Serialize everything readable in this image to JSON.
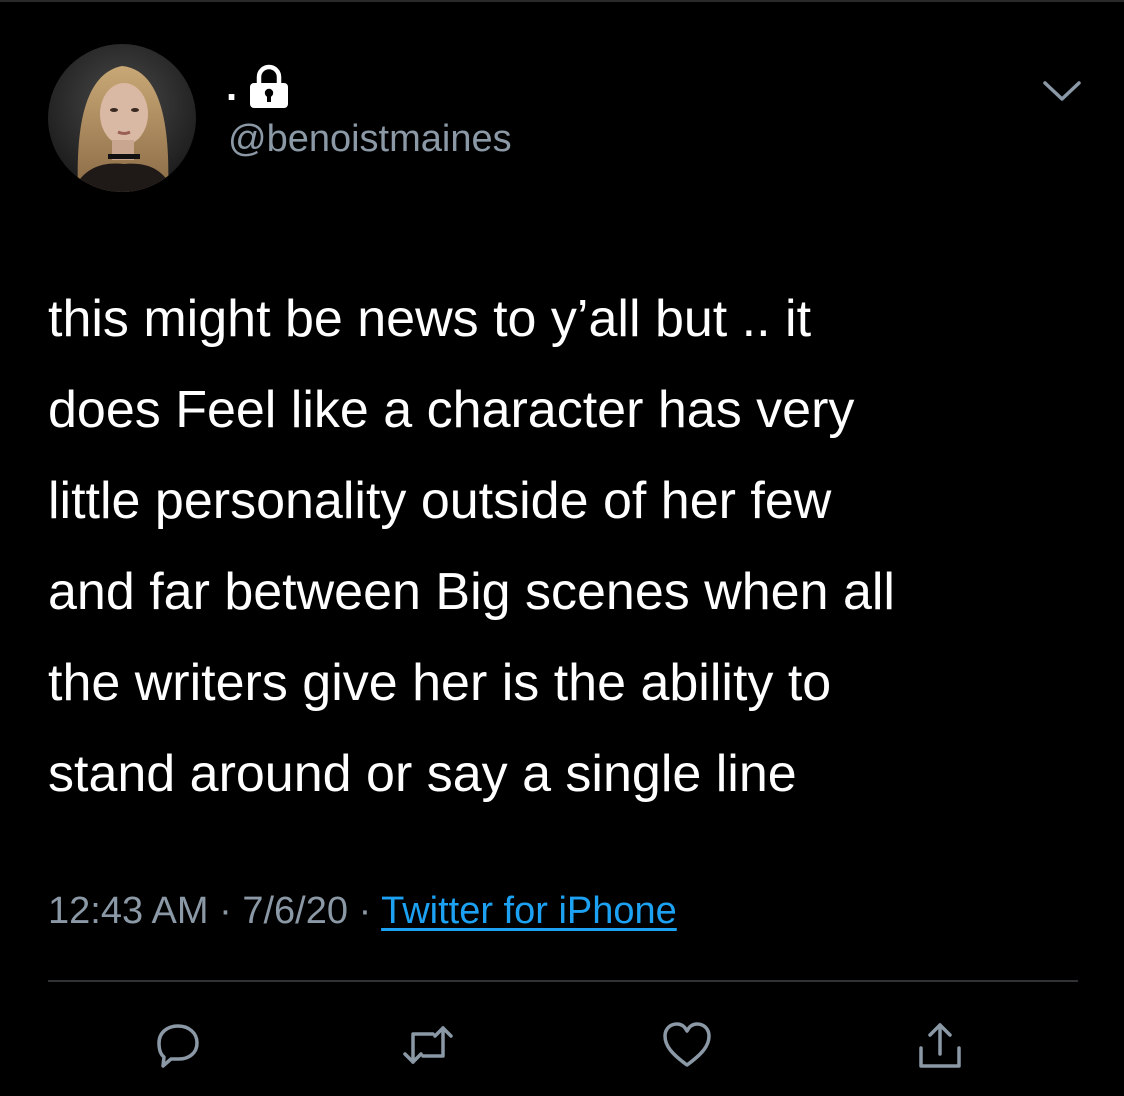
{
  "tweet": {
    "display_name": ".",
    "handle": "@benoistmaines",
    "protected": true,
    "text_lines": [
      "this might be news to y’all but .. it",
      "does Feel like a character has very",
      "little personality outside of her few",
      "and far between Big scenes when all",
      "the writers give her is the ability to",
      "stand around or say a single line"
    ],
    "time": "12:43 AM",
    "date": "7/6/20",
    "separator": "·",
    "source": "Twitter for iPhone"
  },
  "icons": {
    "lock": "lock-icon",
    "caret": "chevron-down-icon",
    "reply": "reply-icon",
    "retweet": "retweet-icon",
    "like": "heart-icon",
    "share": "share-icon"
  },
  "colors": {
    "background": "#000000",
    "text": "#ffffff",
    "secondary": "#8b98a5",
    "link": "#1da1f2",
    "divider": "#2f3336"
  }
}
